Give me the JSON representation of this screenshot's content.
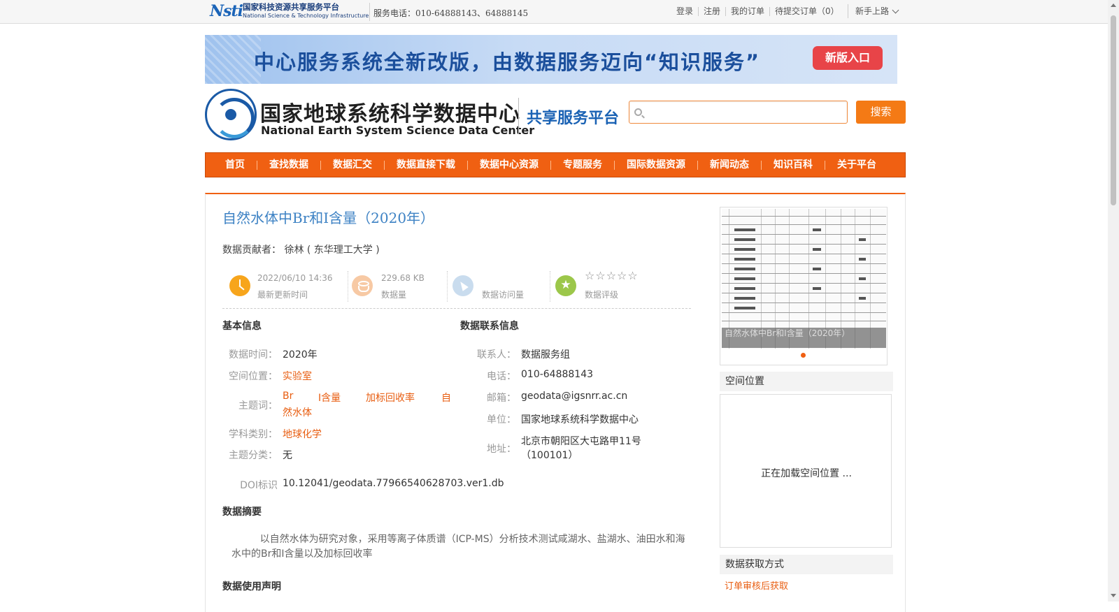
{
  "topbar": {
    "logo_mark": "Nsti",
    "logo_cn": "国家科技资源共享服务平台",
    "logo_en": "National Science & Technology Infrastructure",
    "service_phone": "服务电话：010-64888143、64888145",
    "links": [
      "登录",
      "注册",
      "我的订单",
      "待提交订单（0）"
    ],
    "guide": "新手上路"
  },
  "banner": {
    "text": "中心服务系统全新改版，由数据服务迈向“知识服务”",
    "button": "新版入口"
  },
  "header": {
    "site_cn": "国家地球系统科学数据中心",
    "site_en": "National Earth System Science Data Center",
    "platform": "共享服务平台",
    "search_placeholder": "",
    "search_button": "搜索"
  },
  "nav": [
    "首页",
    "查找数据",
    "数据汇交",
    "数据直接下载",
    "数据中心资源",
    "专题服务",
    "国际数据资源",
    "新闻动态",
    "知识百科",
    "关于平台"
  ],
  "dataset": {
    "title": "自然水体中Br和I含量（2020年）",
    "contributor": "数据贡献者： 徐林 ( 东华理工大学 )"
  },
  "stats": {
    "updated_value": "2022/06/10 14:36",
    "updated_label": "最新更新时间",
    "size_value": "229.68 KB",
    "size_label": "数据量",
    "views_value": "",
    "views_label": "数据访问量",
    "rating_stars": "☆☆☆☆☆",
    "rating_value": 0,
    "rating_label": "数据评级"
  },
  "basic_info": {
    "heading": "基本信息",
    "time_label": "数据时间：",
    "time_value": "2020年",
    "location_label": "空间位置：",
    "location_value": "实验室",
    "keywords_label": "主题词：",
    "keywords": [
      "Br",
      "I含量",
      "加标回收率",
      "自",
      "然水体"
    ],
    "discipline_label": "学科类别：",
    "discipline_value": "地球化学",
    "category_label": "主题分类：",
    "category_value": "无",
    "doi_label": "DOI标识",
    "doi_value": "10.12041/geodata.77966540628703.ver1.db"
  },
  "contact_info": {
    "heading": "数据联系信息",
    "contact_label": "联系人：",
    "contact_value": "数据服务组",
    "phone_label": "电话：",
    "phone_value": "010-64888143",
    "email_label": "邮箱：",
    "email_value": "geodata@igsnrr.ac.cn",
    "unit_label": "单位：",
    "unit_value": "国家地球系统科学数据中心",
    "address_label": "地址：",
    "address_line1": "北京市朝阳区大屯路甲11号",
    "address_line2": "（100101）"
  },
  "abstract": {
    "heading": "数据摘要",
    "text": "以自然水体为研究对象，采用等离子体质谱（ICP-MS）分析技术测试咸湖水、盐湖水、油田水和海水中的Br和I含量以及加标回收率"
  },
  "usage": {
    "heading": "数据使用声明"
  },
  "sidebar": {
    "preview_caption": "自然水体中Br和I含量（2020年）",
    "spatial_heading": "空间位置",
    "map_loading": "正在加载空间位置 ...",
    "access_heading": "数据获取方式",
    "access_link": "订单审核后获取"
  },
  "colors": {
    "accent": "#f06012",
    "link": "#e85d10",
    "title": "#3d82c4"
  }
}
